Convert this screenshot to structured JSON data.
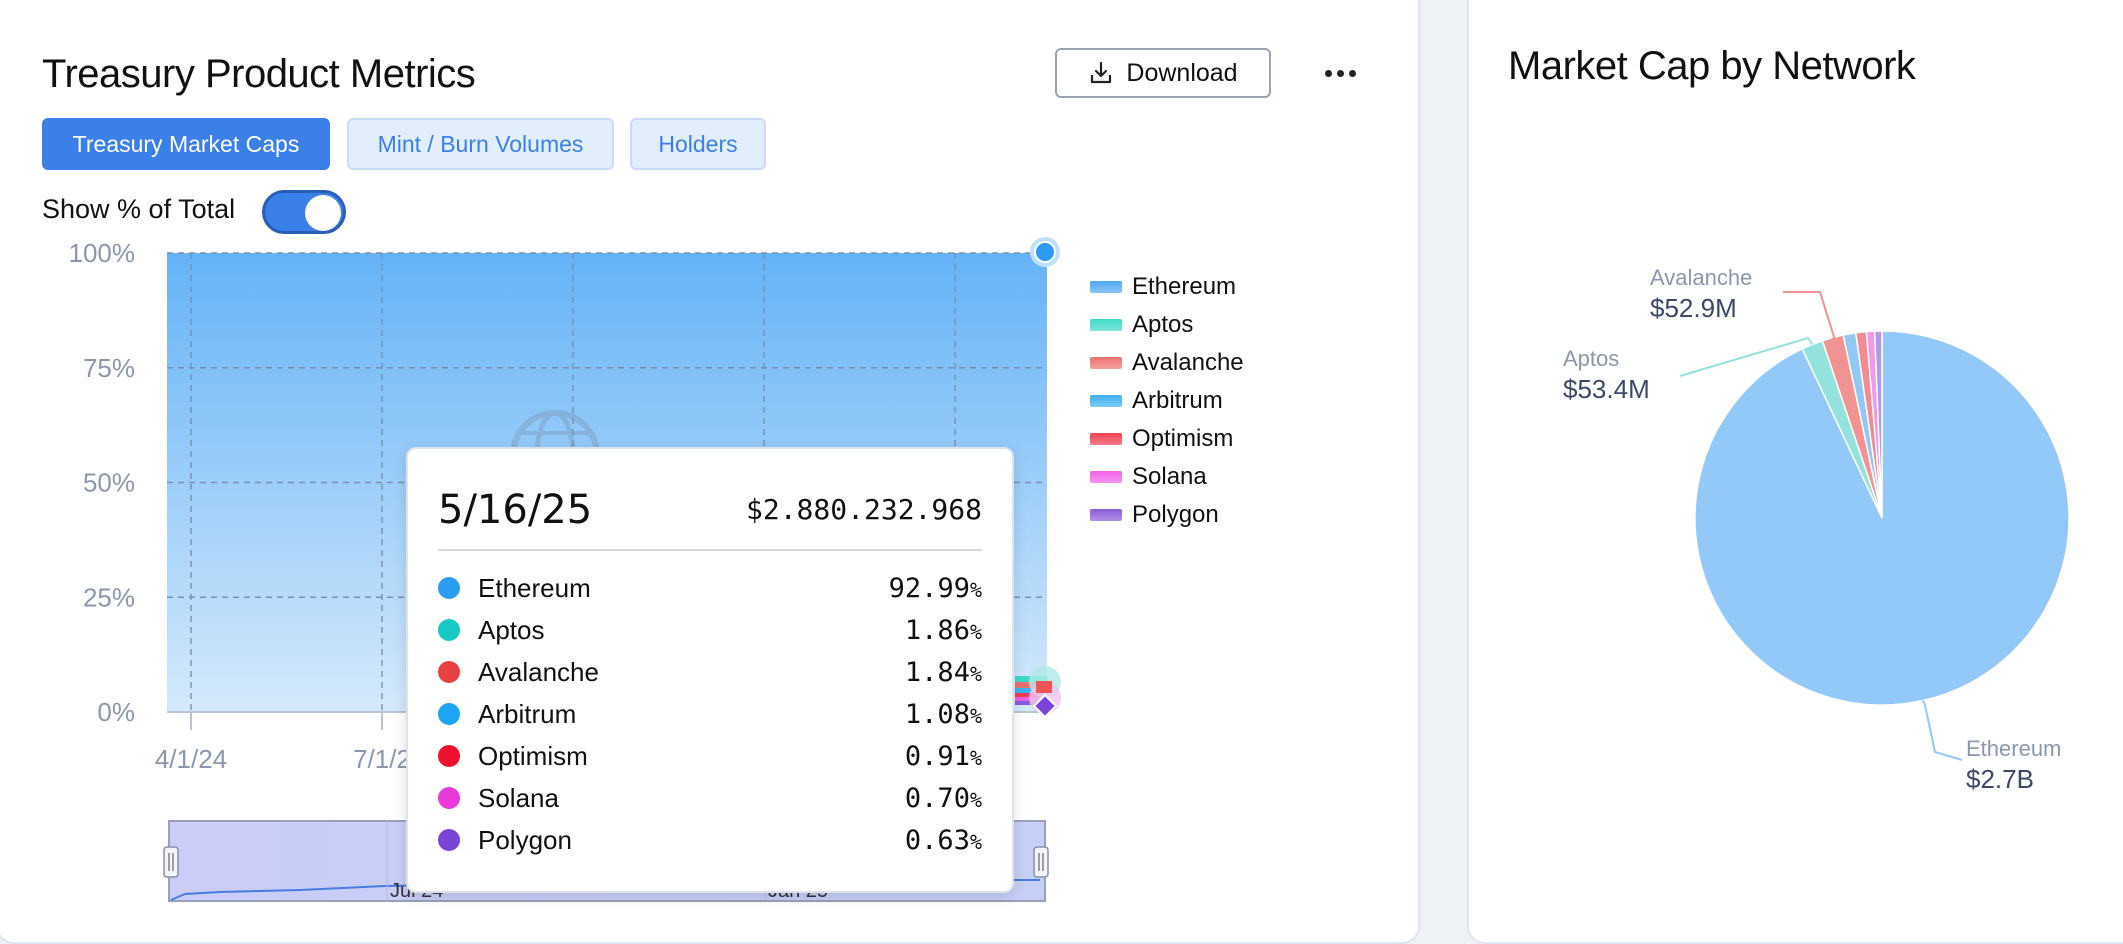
{
  "left_panel": {
    "title": "Treasury Product Metrics",
    "download_label": "Download",
    "tabs": [
      {
        "label": "Treasury Market Caps",
        "active": true
      },
      {
        "label": "Mint / Burn Volumes",
        "active": false
      },
      {
        "label": "Holders",
        "active": false
      }
    ],
    "toggle": {
      "label": "Show % of Total",
      "on": true
    }
  },
  "right_panel": {
    "title": "Market Cap by Network"
  },
  "tooltip": {
    "date": "5/16/25",
    "total": "$2.880.232.968",
    "rows": [
      {
        "name": "Ethereum",
        "pct": "92.99",
        "unit": "%",
        "color": "#2b9cf2"
      },
      {
        "name": "Aptos",
        "pct": "1.86",
        "unit": "%",
        "color": "#17c9c4"
      },
      {
        "name": "Avalanche",
        "pct": "1.84",
        "unit": "%",
        "color": "#e84142"
      },
      {
        "name": "Arbitrum",
        "pct": "1.08",
        "unit": "%",
        "color": "#1ea4f5"
      },
      {
        "name": "Optimism",
        "pct": "0.91",
        "unit": "%",
        "color": "#f0102f"
      },
      {
        "name": "Solana",
        "pct": "0.70",
        "unit": "%",
        "color": "#e83ad8"
      },
      {
        "name": "Polygon",
        "pct": "0.63",
        "unit": "%",
        "color": "#7a44d8"
      }
    ]
  },
  "chart_data": [
    {
      "type": "area",
      "stacked": true,
      "normalized": true,
      "y_tick_labels": [
        "100%",
        "75%",
        "50%",
        "25%",
        "0%"
      ],
      "x_tick_labels": [
        "4/1/24",
        "7/1/2"
      ],
      "ylim": [
        0,
        100
      ],
      "grid": true,
      "legend_position": "right",
      "series": [
        {
          "name": "Ethereum",
          "color": "#4fa8f5"
        },
        {
          "name": "Aptos",
          "color": "#3dd9c8"
        },
        {
          "name": "Avalanche",
          "color": "#f07070"
        },
        {
          "name": "Arbitrum",
          "color": "#3cb1f0"
        },
        {
          "name": "Optimism",
          "color": "#f04050"
        },
        {
          "name": "Solana",
          "color": "#f060e8"
        },
        {
          "name": "Polygon",
          "color": "#8a5ad8"
        }
      ],
      "navigator_labels": [
        "Jul 24",
        "Jan 25"
      ]
    },
    {
      "type": "pie",
      "slices": [
        {
          "name": "Ethereum",
          "value": 2678,
          "label_name": "Ethereum",
          "label_value": "$2.7B",
          "color": "#93c9f8"
        },
        {
          "name": "Aptos",
          "value": 53.4,
          "label_name": "Aptos",
          "label_value": "$53.4M",
          "color": "#93e2dd"
        },
        {
          "name": "Avalanche",
          "value": 52.9,
          "label_name": "Avalanche",
          "label_value": "$52.9M",
          "color": "#f29393"
        },
        {
          "name": "Arbitrum",
          "value": 31.1,
          "color": "#92c8f4"
        },
        {
          "name": "Optimism",
          "value": 26.2,
          "color": "#f48a94"
        },
        {
          "name": "Solana",
          "value": 20.2,
          "color": "#f199e9"
        },
        {
          "name": "Polygon",
          "value": 18.1,
          "color": "#b29ae6"
        }
      ]
    }
  ]
}
